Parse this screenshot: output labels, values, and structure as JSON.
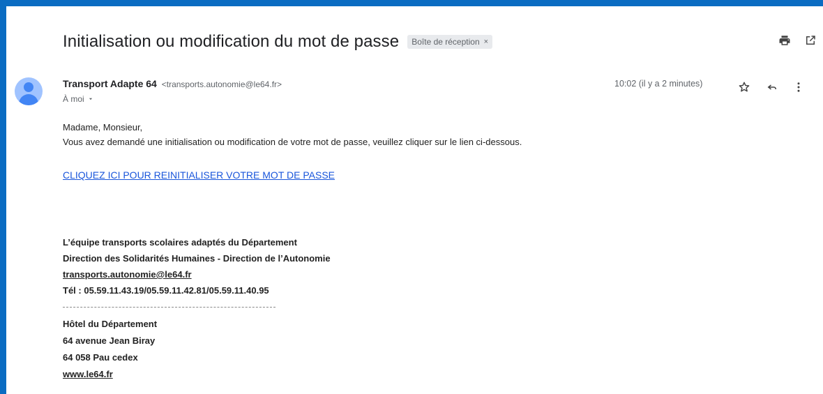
{
  "email": {
    "subject": "Initialisation ou modification du mot de passe",
    "label": "Boîte de réception",
    "label_close": "×",
    "sender_name": "Transport Adapte 64",
    "sender_email": "<transports.autonomie@le64.fr>",
    "recipient": "À moi",
    "timestamp": "10:02 (il y a 2 minutes)"
  },
  "body": {
    "greeting": "Madame, Monsieur,",
    "message": "Vous avez demandé une initialisation ou modification de votre mot de passe, veuillez cliquer sur le lien ci-dessous.",
    "reset_link": "CLIQUEZ ICI POUR REINITIALISER VOTRE MOT DE PASSE"
  },
  "signature": {
    "team": "L’équipe transports scolaires adaptés du Département",
    "direction": "Direction des Solidarités Humaines - Direction de l’Autonomie",
    "email": "transports.autonomie@le64.fr",
    "phone": "Tél : 05.59.11.43.19/05.59.11.42.81/05.59.11.40.95",
    "building": "Hôtel du Département",
    "street": "64 avenue Jean Biray",
    "city": "64 058 Pau cedex",
    "website": "www.le64.fr"
  },
  "icons": {
    "print": "print-icon",
    "open_new_window": "open-in-new-window-icon",
    "star": "star-icon",
    "reply": "reply-icon",
    "more": "more-vertical-icon",
    "dropdown": "chevron-down-icon"
  },
  "colors": {
    "frame": "#0a6cc2",
    "link": "#1a56db",
    "avatar_bg": "#a0c3ff",
    "avatar_fg": "#4285f4"
  }
}
